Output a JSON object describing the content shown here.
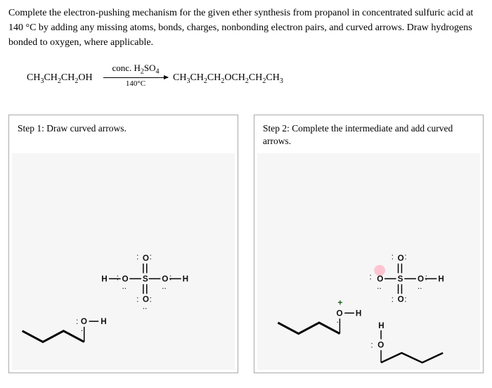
{
  "instructions": "Complete the electron-pushing mechanism for the given ether synthesis from propanol in concentrated sulfuric acid at 140 °C by adding any missing atoms, bonds, charges, nonbonding electron pairs, and curved arrows. Draw hydrogens bonded to oxygen, where applicable.",
  "reaction": {
    "reactant": "CH₃CH₂CH₂OH",
    "conditions_top": "conc. H₂SO₄",
    "conditions_bottom": "140°C",
    "product": "CH₃CH₂CH₂OCH₂CH₂CH₃"
  },
  "step1": {
    "title": "Step 1: Draw curved arrows.",
    "atoms": {
      "H_left": "H",
      "O_sl": "O",
      "S": "S",
      "O_sr": "O",
      "H_right": "H",
      "O_top": "O",
      "O_bot": "O",
      "O_propanol": "O",
      "H_propanol": "H"
    }
  },
  "step2": {
    "title": "Step 2: Complete the intermediate and add curved arrows.",
    "atoms": {
      "O_neg": "O",
      "S": "S",
      "O_sr": "O",
      "H_right": "H",
      "O_top": "O",
      "O_bot": "O",
      "O_prop1": "O",
      "H_prop1": "H",
      "H_prop2h": "H",
      "O_prop2": "O",
      "plus": "+"
    }
  }
}
